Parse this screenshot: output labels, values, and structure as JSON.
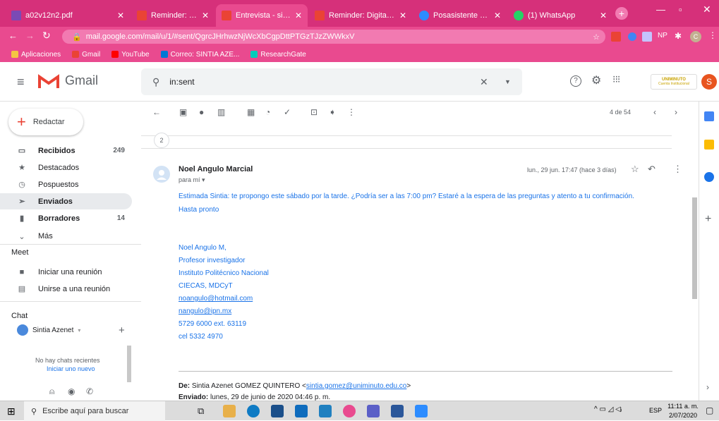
{
  "browser": {
    "tabs": [
      {
        "label": "a02v12n2.pdf",
        "color": "#7b4ab5"
      },
      {
        "label": "Reminder: Digitaliza tu",
        "color": "#ea4335"
      },
      {
        "label": "Entrevista - sintia.gome",
        "color": "#ea4335"
      },
      {
        "label": "Reminder: Digitaliza tu",
        "color": "#ea4335"
      },
      {
        "label": "Posasistente - Zoom",
        "color": "#2d8cff"
      },
      {
        "label": "(1) WhatsApp",
        "color": "#25d366"
      }
    ],
    "url": "mail.google.com/mail/u/1/#sent/QgrcJHrhwzNjWcXbCgpDttPTGzTJzZWWkxV",
    "bookmarks": [
      "Aplicaciones",
      "Gmail",
      "YouTube",
      "Correo: SINTIA AZE...",
      "ResearchGate"
    ],
    "ext_np": "NP",
    "ext_c": "C"
  },
  "gmail": {
    "logo_text": "Gmail",
    "search_value": "in:sent",
    "account_initial": "S",
    "org_logo_text": "UNIMINUTO",
    "org_logo_sub": "Cuenta Institucional"
  },
  "sidebar": {
    "compose_label": "Redactar",
    "items": [
      {
        "label": "Recibidos",
        "count": "249",
        "icon": "inbox-icon"
      },
      {
        "label": "Destacados",
        "count": "",
        "icon": "star-icon"
      },
      {
        "label": "Pospuestos",
        "count": "",
        "icon": "clock-icon"
      },
      {
        "label": "Enviados",
        "count": "",
        "icon": "send-icon"
      },
      {
        "label": "Borradores",
        "count": "14",
        "icon": "draft-icon"
      },
      {
        "label": "Más",
        "count": "",
        "icon": "chevron-down-icon"
      }
    ],
    "meet_title": "Meet",
    "meet_items": [
      "Iniciar una reunión",
      "Unirse a una reunión"
    ],
    "chat_title": "Chat",
    "chat_user": "Sintia Azenet",
    "no_chats": "No hay chats recientes",
    "start_new": "Iniciar uno nuevo"
  },
  "toolbar": {
    "pager": "4 de 54"
  },
  "thread": {
    "collapsed_count": "2",
    "sender": "Noel Angulo Marcial",
    "to": "para mí",
    "date": "lun., 29 jun. 17:47 (hace 3 días)",
    "body_line1": "Estimada Sintia:  te propongo este sábado por la tarde.  ¿Podría ser a las 7:00 pm? Estaré a la espera de las preguntas y atento a tu confirmación.",
    "body_line2": "Hasta pronto",
    "signature": [
      "Noel Angulo M,",
      "Profesor investigador",
      "Instituto Politécnico Nacional",
      "CIECAS, MDCyT"
    ],
    "links": [
      "noangulo@hotmail.com",
      "nangulo@ipn.mx"
    ],
    "phones": [
      "5729 6000 ext. 63119",
      "cel 5332 4970"
    ],
    "quoted_from_label": "De:",
    "quoted_from": "Sintia Azenet GOMEZ QUINTERO <",
    "quoted_from_email": "sintia.gomez@uniminuto.edu.co",
    "quoted_from_end": ">",
    "quoted_sent_label": "Enviado:",
    "quoted_sent": "lunes, 29 de junio de 2020 04:46 p. m."
  },
  "taskbar": {
    "search_placeholder": "Escribe aquí para buscar",
    "lang": "ESP",
    "time": "11:11 a. m.",
    "date": "2/07/2020"
  }
}
